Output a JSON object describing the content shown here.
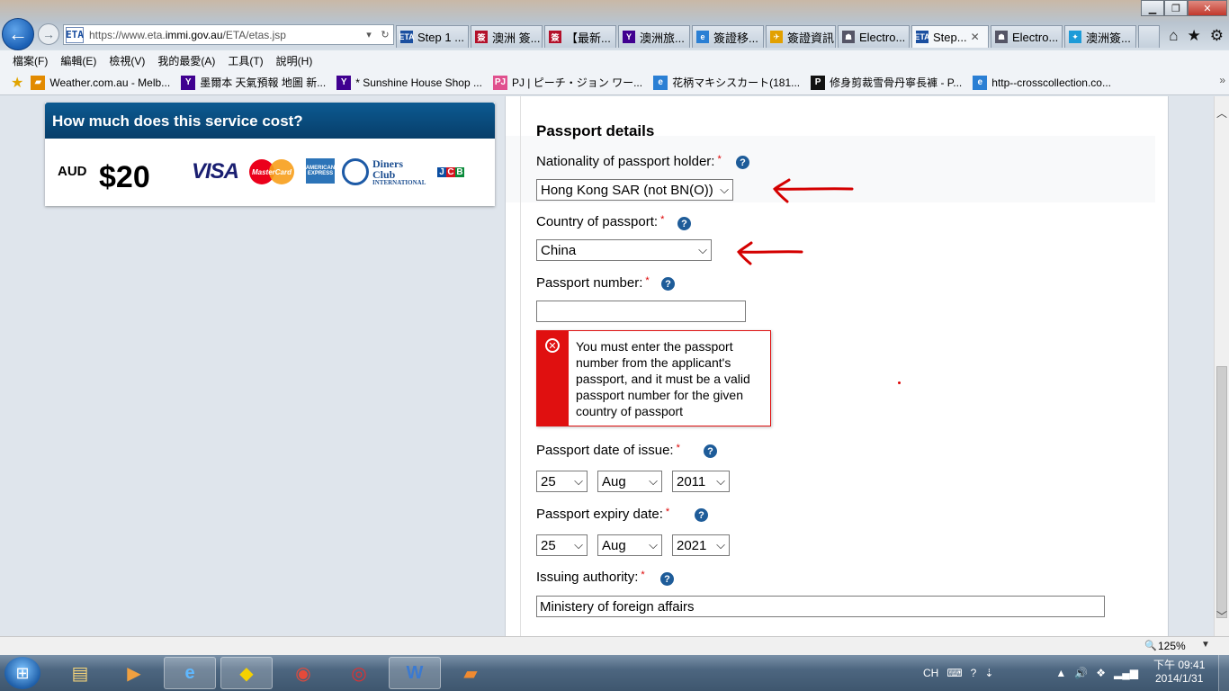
{
  "browser": {
    "url_prefix": "https://www.eta.",
    "url_domain": "immi.gov.au",
    "url_suffix": "/ETA/etas.jsp",
    "favicon": "ETA",
    "tabs": [
      {
        "label": "Step 1 ...",
        "icon": "ETA",
        "icon_color": "#1b4fa0"
      },
      {
        "label": "澳洲 簽...",
        "icon": "簽",
        "icon_color": "#b3102a"
      },
      {
        "label": "【最新...",
        "icon": "簽",
        "icon_color": "#b3102a"
      },
      {
        "label": "澳洲旅...",
        "icon": "Y",
        "icon_color": "#400090"
      },
      {
        "label": "簽證移...",
        "icon": "e",
        "icon_color": "#2a7fd4"
      },
      {
        "label": "簽證資訊",
        "icon": "✈",
        "icon_color": "#e2a000"
      },
      {
        "label": "Electro...",
        "icon": "☗",
        "icon_color": "#556"
      },
      {
        "label": "Step...",
        "icon": "ETA",
        "icon_color": "#1b4fa0",
        "active": true,
        "close": "✕"
      },
      {
        "label": "Electro...",
        "icon": "☗",
        "icon_color": "#556"
      },
      {
        "label": "澳洲簽...",
        "icon": "✦",
        "icon_color": "#1d9bd8"
      }
    ],
    "menu": [
      "檔案(F)",
      "編輯(E)",
      "檢視(V)",
      "我的最愛(A)",
      "工具(T)",
      "說明(H)"
    ],
    "favorites": [
      {
        "label": "Weather.com.au - Melb...",
        "icon": "▰",
        "icon_color": "#e28a00"
      },
      {
        "label": "墨爾本 天氣預報 地圖 新...",
        "icon": "Y",
        "icon_color": "#400090"
      },
      {
        "label": "* Sunshine House Shop ...",
        "icon": "Y",
        "icon_color": "#400090"
      },
      {
        "label": "PJ | ピーチ・ジョン ワー...",
        "icon": "PJ",
        "icon_color": "#e0508e"
      },
      {
        "label": "花柄マキシスカート(181...",
        "icon": "e",
        "icon_color": "#2a7fd4"
      },
      {
        "label": "修身剪裁雪骨丹寧長褲 - P...",
        "icon": "P",
        "icon_color": "#111"
      },
      {
        "label": "http--crosscollection.co...",
        "icon": "e",
        "icon_color": "#2a7fd4"
      }
    ],
    "zoom": "125%"
  },
  "cost": {
    "header": "How much does this service cost?",
    "currency": "AUD",
    "amount": "$20",
    "cards": {
      "visa": "VISA",
      "mastercard": "MasterCard",
      "amex": "AMERICAN EXPRESS",
      "diners_main": "Diners Club",
      "diners_sub": "INTERNATIONAL",
      "jcb": [
        "J",
        "C",
        "B"
      ]
    }
  },
  "form": {
    "section_title": "Passport details",
    "required_mark": "*",
    "help": "?",
    "nationality": {
      "label": "Nationality of passport holder:",
      "value": "Hong Kong SAR (not BN(O))"
    },
    "country": {
      "label": "Country of passport:",
      "value": "China"
    },
    "passport_number": {
      "label": "Passport number:",
      "value": ""
    },
    "error": "You must enter the passport number from the applicant's passport, and it must be a valid passport number for the given country of passport",
    "issue_date": {
      "label": "Passport date of issue:",
      "day": "25",
      "month": "Aug",
      "year": "2011"
    },
    "expiry_date": {
      "label": "Passport expiry date:",
      "day": "25",
      "month": "Aug",
      "year": "2021"
    },
    "issuing_authority": {
      "label": "Issuing authority:",
      "value": "Ministery of foreign affairs"
    }
  },
  "annotation_color": "#d40000",
  "taskbar": {
    "tray_lang": "CH",
    "clock_period_time": "下午 09:41",
    "clock_date": "2014/1/31"
  }
}
